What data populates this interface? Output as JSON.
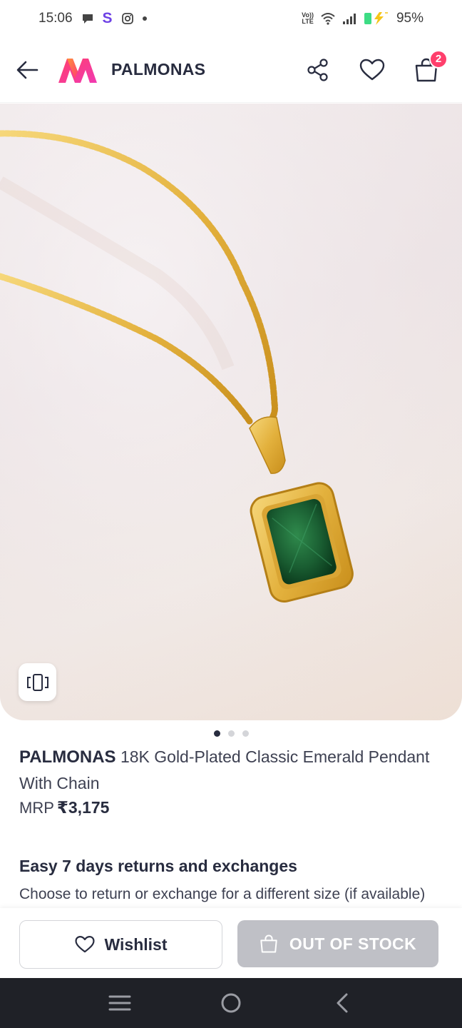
{
  "status_bar": {
    "time": "15:06",
    "app_s": "S",
    "battery": "95%",
    "volte": "Vo)) LTE"
  },
  "header": {
    "brand_title": "PALMONAS",
    "cart_count": "2",
    "accent_color": "#ff3f6c"
  },
  "product": {
    "brand": "PALMONAS",
    "name": "18K Gold-Plated Classic Emerald Pendant With Chain",
    "mrp_label": "MRP",
    "price": "₹3,175",
    "image_description_icon": "necklace-image",
    "carousel_total": 3,
    "carousel_active": 1
  },
  "returns": {
    "title": "Easy 7 days returns and exchanges",
    "description": "Choose to return or exchange for a different size (if available)"
  },
  "actions": {
    "wishlist_label": "Wishlist",
    "out_of_stock_label": "OUT OF STOCK"
  },
  "icons": {
    "back": "arrow-left-icon",
    "share": "share-icon",
    "wishlist": "heart-icon",
    "bag": "shopping-bag-icon",
    "similar": "view-similar-icon",
    "nav_menu": "menu-icon",
    "nav_home": "home-circle-icon",
    "nav_back": "chevron-left-icon"
  }
}
